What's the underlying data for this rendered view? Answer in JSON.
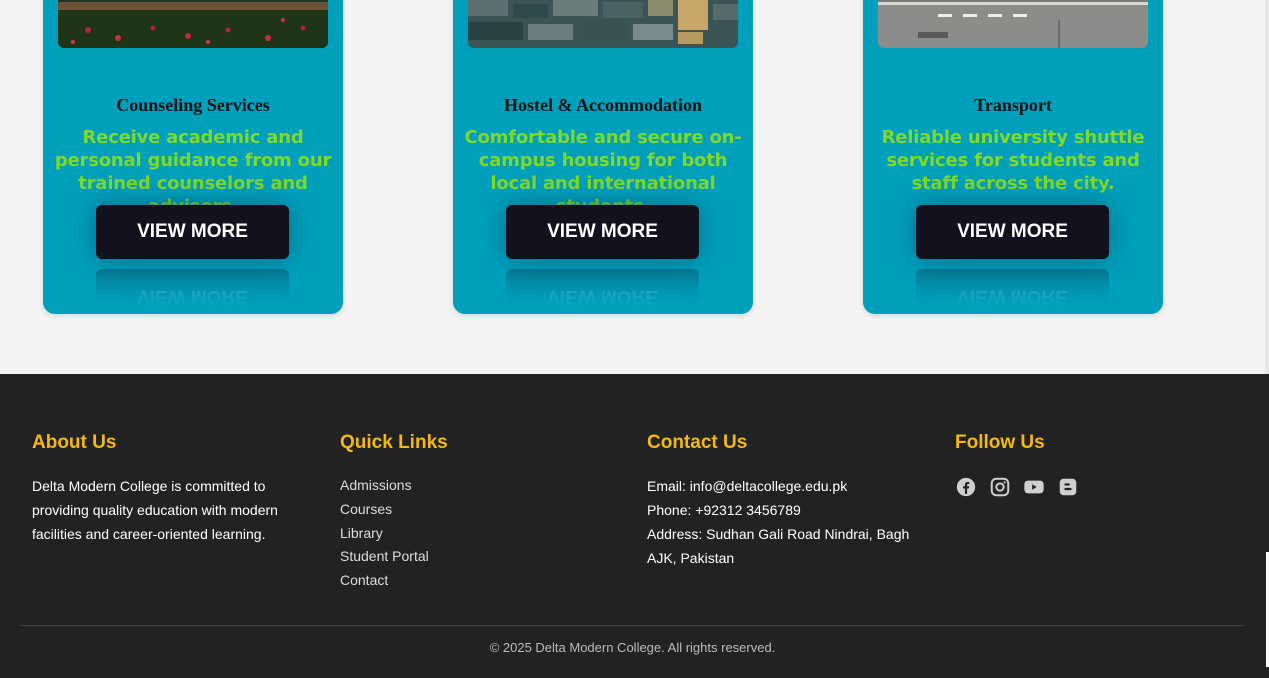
{
  "cards": [
    {
      "title": "Counseling Services",
      "desc": "Receive academic and personal guidance from our trained counselors and advisors.",
      "button": "VIEW MORE"
    },
    {
      "title": "Hostel & Accommodation",
      "desc": "Comfortable and secure on-campus housing for both local and international students.",
      "button": "VIEW MORE"
    },
    {
      "title": "Transport",
      "desc": "Reliable university shuttle services for students and staff across the city.",
      "button": "VIEW MORE"
    }
  ],
  "footer": {
    "about": {
      "heading": "About Us",
      "text": "Delta Modern College is committed to providing quality education with modern facilities and career-oriented learning."
    },
    "quick_links": {
      "heading": "Quick Links",
      "items": [
        "Admissions",
        "Courses",
        "Library",
        "Student Portal",
        "Contact"
      ]
    },
    "contact": {
      "heading": "Contact Us",
      "email": "Email: info@deltacollege.edu.pk",
      "phone": "Phone: +92312 3456789",
      "address": "Address: Sudhan Gali Road Nindrai, Bagh AJK, Pakistan"
    },
    "follow": {
      "heading": "Follow Us",
      "icons": [
        "facebook-icon",
        "instagram-icon",
        "youtube-icon",
        "blogger-icon"
      ]
    },
    "copyright": "© 2025 Delta Modern College. All rights reserved."
  },
  "colors": {
    "card_bg": "#00a0bd",
    "desc_text": "#7fd926",
    "button_bg": "#12121e",
    "footer_bg": "#222222",
    "footer_heading": "#f5b80f"
  }
}
